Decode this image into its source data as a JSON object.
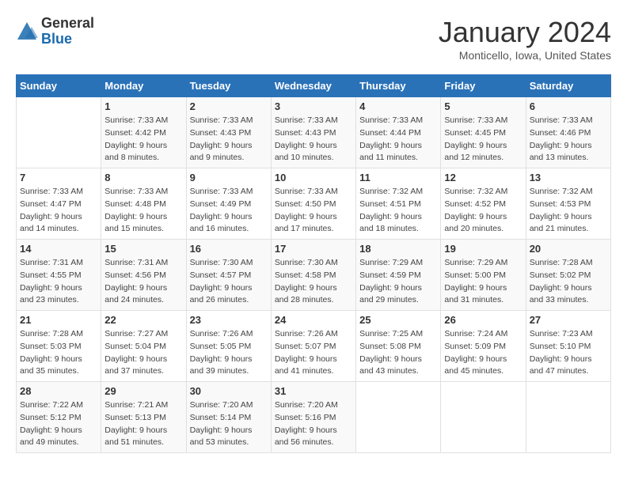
{
  "logo": {
    "general": "General",
    "blue": "Blue"
  },
  "title": "January 2024",
  "location": "Monticello, Iowa, United States",
  "days_of_week": [
    "Sunday",
    "Monday",
    "Tuesday",
    "Wednesday",
    "Thursday",
    "Friday",
    "Saturday"
  ],
  "weeks": [
    [
      {
        "day": "",
        "info": ""
      },
      {
        "day": "1",
        "info": "Sunrise: 7:33 AM\nSunset: 4:42 PM\nDaylight: 9 hours\nand 8 minutes."
      },
      {
        "day": "2",
        "info": "Sunrise: 7:33 AM\nSunset: 4:43 PM\nDaylight: 9 hours\nand 9 minutes."
      },
      {
        "day": "3",
        "info": "Sunrise: 7:33 AM\nSunset: 4:43 PM\nDaylight: 9 hours\nand 10 minutes."
      },
      {
        "day": "4",
        "info": "Sunrise: 7:33 AM\nSunset: 4:44 PM\nDaylight: 9 hours\nand 11 minutes."
      },
      {
        "day": "5",
        "info": "Sunrise: 7:33 AM\nSunset: 4:45 PM\nDaylight: 9 hours\nand 12 minutes."
      },
      {
        "day": "6",
        "info": "Sunrise: 7:33 AM\nSunset: 4:46 PM\nDaylight: 9 hours\nand 13 minutes."
      }
    ],
    [
      {
        "day": "7",
        "info": "Sunrise: 7:33 AM\nSunset: 4:47 PM\nDaylight: 9 hours\nand 14 minutes."
      },
      {
        "day": "8",
        "info": "Sunrise: 7:33 AM\nSunset: 4:48 PM\nDaylight: 9 hours\nand 15 minutes."
      },
      {
        "day": "9",
        "info": "Sunrise: 7:33 AM\nSunset: 4:49 PM\nDaylight: 9 hours\nand 16 minutes."
      },
      {
        "day": "10",
        "info": "Sunrise: 7:33 AM\nSunset: 4:50 PM\nDaylight: 9 hours\nand 17 minutes."
      },
      {
        "day": "11",
        "info": "Sunrise: 7:32 AM\nSunset: 4:51 PM\nDaylight: 9 hours\nand 18 minutes."
      },
      {
        "day": "12",
        "info": "Sunrise: 7:32 AM\nSunset: 4:52 PM\nDaylight: 9 hours\nand 20 minutes."
      },
      {
        "day": "13",
        "info": "Sunrise: 7:32 AM\nSunset: 4:53 PM\nDaylight: 9 hours\nand 21 minutes."
      }
    ],
    [
      {
        "day": "14",
        "info": "Sunrise: 7:31 AM\nSunset: 4:55 PM\nDaylight: 9 hours\nand 23 minutes."
      },
      {
        "day": "15",
        "info": "Sunrise: 7:31 AM\nSunset: 4:56 PM\nDaylight: 9 hours\nand 24 minutes."
      },
      {
        "day": "16",
        "info": "Sunrise: 7:30 AM\nSunset: 4:57 PM\nDaylight: 9 hours\nand 26 minutes."
      },
      {
        "day": "17",
        "info": "Sunrise: 7:30 AM\nSunset: 4:58 PM\nDaylight: 9 hours\nand 28 minutes."
      },
      {
        "day": "18",
        "info": "Sunrise: 7:29 AM\nSunset: 4:59 PM\nDaylight: 9 hours\nand 29 minutes."
      },
      {
        "day": "19",
        "info": "Sunrise: 7:29 AM\nSunset: 5:00 PM\nDaylight: 9 hours\nand 31 minutes."
      },
      {
        "day": "20",
        "info": "Sunrise: 7:28 AM\nSunset: 5:02 PM\nDaylight: 9 hours\nand 33 minutes."
      }
    ],
    [
      {
        "day": "21",
        "info": "Sunrise: 7:28 AM\nSunset: 5:03 PM\nDaylight: 9 hours\nand 35 minutes."
      },
      {
        "day": "22",
        "info": "Sunrise: 7:27 AM\nSunset: 5:04 PM\nDaylight: 9 hours\nand 37 minutes."
      },
      {
        "day": "23",
        "info": "Sunrise: 7:26 AM\nSunset: 5:05 PM\nDaylight: 9 hours\nand 39 minutes."
      },
      {
        "day": "24",
        "info": "Sunrise: 7:26 AM\nSunset: 5:07 PM\nDaylight: 9 hours\nand 41 minutes."
      },
      {
        "day": "25",
        "info": "Sunrise: 7:25 AM\nSunset: 5:08 PM\nDaylight: 9 hours\nand 43 minutes."
      },
      {
        "day": "26",
        "info": "Sunrise: 7:24 AM\nSunset: 5:09 PM\nDaylight: 9 hours\nand 45 minutes."
      },
      {
        "day": "27",
        "info": "Sunrise: 7:23 AM\nSunset: 5:10 PM\nDaylight: 9 hours\nand 47 minutes."
      }
    ],
    [
      {
        "day": "28",
        "info": "Sunrise: 7:22 AM\nSunset: 5:12 PM\nDaylight: 9 hours\nand 49 minutes."
      },
      {
        "day": "29",
        "info": "Sunrise: 7:21 AM\nSunset: 5:13 PM\nDaylight: 9 hours\nand 51 minutes."
      },
      {
        "day": "30",
        "info": "Sunrise: 7:20 AM\nSunset: 5:14 PM\nDaylight: 9 hours\nand 53 minutes."
      },
      {
        "day": "31",
        "info": "Sunrise: 7:20 AM\nSunset: 5:16 PM\nDaylight: 9 hours\nand 56 minutes."
      },
      {
        "day": "",
        "info": ""
      },
      {
        "day": "",
        "info": ""
      },
      {
        "day": "",
        "info": ""
      }
    ]
  ]
}
